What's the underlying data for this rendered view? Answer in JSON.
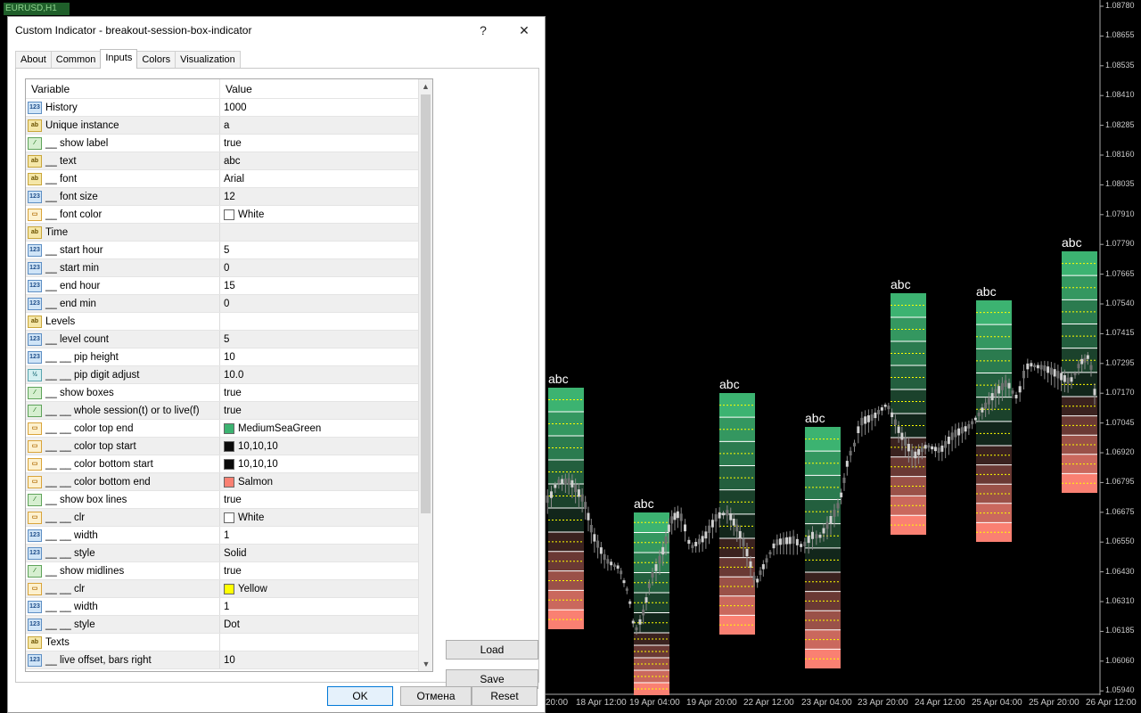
{
  "chart": {
    "symbol": "EURUSD,H1",
    "box_label": "abc",
    "price_labels": [
      "1.08780",
      "1.08655",
      "1.08535",
      "1.08410",
      "1.08285",
      "1.08160",
      "1.08035",
      "1.07910",
      "1.07790",
      "1.07665",
      "1.07540",
      "1.07415",
      "1.07295",
      "1.07170",
      "1.07045",
      "1.06920",
      "1.06795",
      "1.06675",
      "1.06550",
      "1.06430",
      "1.06310",
      "1.06185",
      "1.06060",
      "1.05940"
    ],
    "time_labels": [
      "20:00",
      "18 Apr 12:00",
      "19 Apr 04:00",
      "19 Apr 20:00",
      "22 Apr 12:00",
      "23 Apr 04:00",
      "23 Apr 20:00",
      "24 Apr 12:00",
      "25 Apr 04:00",
      "25 Apr 20:00",
      "26 Apr 12:00"
    ],
    "colors": {
      "top_end": "#3CB371",
      "top_start": "#0A0A0A",
      "bottom_start": "#0A0A0A",
      "bottom_end": "#FA8072",
      "midline": "#FFFF00",
      "box_line": "#FFFFFF"
    }
  },
  "dialog": {
    "title": "Custom Indicator - breakout-session-box-indicator",
    "help": "?",
    "close": "✕",
    "tabs": [
      "About",
      "Common",
      "Inputs",
      "Colors",
      "Visualization"
    ],
    "active_tab": "Inputs",
    "columns": {
      "variable": "Variable",
      "value": "Value"
    },
    "rows": [
      {
        "icon": "int",
        "var": "History",
        "val": "1000"
      },
      {
        "icon": "str",
        "var": "Unique instance",
        "val": "a"
      },
      {
        "icon": "bool",
        "var": "__ show label",
        "val": "true"
      },
      {
        "icon": "str",
        "var": "__ text",
        "val": "abc"
      },
      {
        "icon": "str",
        "var": "__ font",
        "val": "Arial"
      },
      {
        "icon": "int",
        "var": "__ font size",
        "val": "12"
      },
      {
        "icon": "color",
        "var": "__ font color",
        "val": "White",
        "swatch": "#FFFFFF"
      },
      {
        "icon": "str",
        "var": "Time",
        "val": ""
      },
      {
        "icon": "int",
        "var": "__ start hour",
        "val": "5"
      },
      {
        "icon": "int",
        "var": "__ start min",
        "val": "0"
      },
      {
        "icon": "int",
        "var": "__ end hour",
        "val": "15"
      },
      {
        "icon": "int",
        "var": "__ end min",
        "val": "0"
      },
      {
        "icon": "str",
        "var": "Levels",
        "val": ""
      },
      {
        "icon": "int",
        "var": "__ level count",
        "val": "5"
      },
      {
        "icon": "int",
        "var": "__ __ pip height",
        "val": "10"
      },
      {
        "icon": "dbl",
        "var": "__ __ pip digit adjust",
        "val": "10.0"
      },
      {
        "icon": "bool",
        "var": "__ show boxes",
        "val": "true"
      },
      {
        "icon": "bool",
        "var": "__ __ whole session(t) or to live(f)",
        "val": "true"
      },
      {
        "icon": "color",
        "var": "__ __ color top end",
        "val": "MediumSeaGreen",
        "swatch": "#3CB371"
      },
      {
        "icon": "color",
        "var": "__ __ color top start",
        "val": "10,10,10",
        "swatch": "#0A0A0A"
      },
      {
        "icon": "color",
        "var": "__ __ color bottom start",
        "val": "10,10,10",
        "swatch": "#0A0A0A"
      },
      {
        "icon": "color",
        "var": "__ __ color bottom end",
        "val": "Salmon",
        "swatch": "#FA8072"
      },
      {
        "icon": "bool",
        "var": "__ show box lines",
        "val": "true"
      },
      {
        "icon": "color",
        "var": "__ __ clr",
        "val": "White",
        "swatch": "#FFFFFF"
      },
      {
        "icon": "int",
        "var": "__ __ width",
        "val": "1"
      },
      {
        "icon": "int",
        "var": "__ __ style",
        "val": "Solid"
      },
      {
        "icon": "bool",
        "var": "__ show midlines",
        "val": "true"
      },
      {
        "icon": "color",
        "var": "__ __ clr",
        "val": "Yellow",
        "swatch": "#FFFF00"
      },
      {
        "icon": "int",
        "var": "__ __ width",
        "val": "1"
      },
      {
        "icon": "int",
        "var": "__ __ style",
        "val": "Dot"
      },
      {
        "icon": "str",
        "var": "Texts",
        "val": ""
      },
      {
        "icon": "int",
        "var": "__ live offset, bars right",
        "val": "10"
      }
    ],
    "icon_text": {
      "int": "123",
      "str": "ab",
      "bool": "⁄",
      "dbl": "½",
      "color": "▭"
    },
    "buttons": {
      "load": "Load",
      "save": "Save",
      "ok": "OK",
      "cancel": "Отмена",
      "reset": "Reset"
    }
  }
}
